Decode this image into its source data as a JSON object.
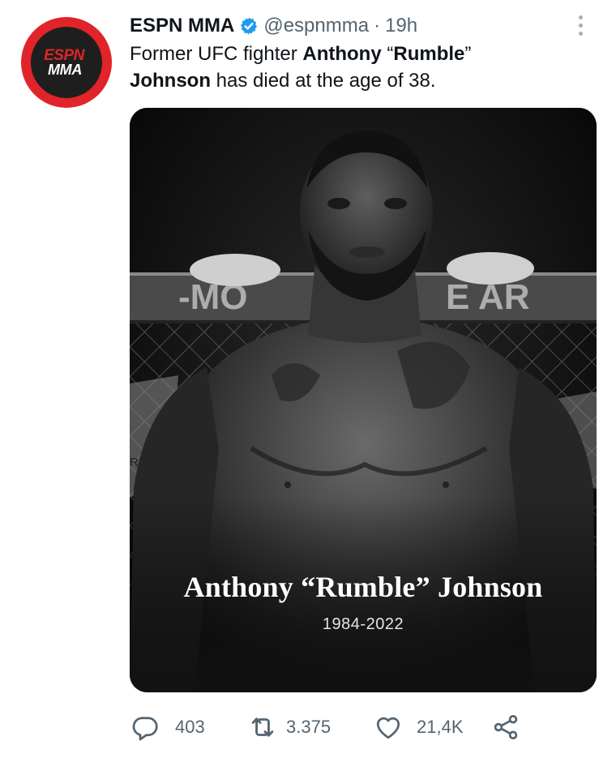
{
  "tweet": {
    "author": {
      "display_name": "ESPN MMA",
      "handle": "@espnmma",
      "verified": true,
      "avatar_logo_top": "ESPN",
      "avatar_logo_bottom": "MMA"
    },
    "separator": "·",
    "time": "19h",
    "text_parts": {
      "p1": "Former UFC fighter ",
      "p2": "Anthony",
      "p3": " “",
      "p4": "Rumble",
      "p5": "”",
      "p6": "Johnson",
      "p7": " has died at the age of 38."
    },
    "media": {
      "caption_name": "Anthony “Rumble” Johnson",
      "caption_years": "1984-2022",
      "banner_text_left": "-MO",
      "banner_text_right": "E AR",
      "sign_text": "Re"
    },
    "actions": {
      "replies": "403",
      "retweets": "3.375",
      "likes": "21,4K"
    },
    "icons": {
      "verified": "verified-badge-icon",
      "more": "more-options-icon",
      "reply": "reply-icon",
      "retweet": "retweet-icon",
      "like": "heart-icon",
      "share": "share-icon"
    },
    "colors": {
      "verified_blue": "#1d9bf0",
      "avatar_red": "#e0242a",
      "secondary_text": "#536471"
    }
  }
}
